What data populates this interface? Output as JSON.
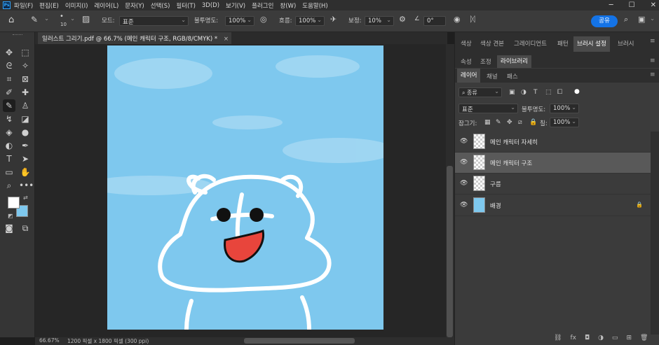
{
  "menubar": {
    "logo": "Ps",
    "items": [
      "파일(F)",
      "편집(E)",
      "이미지(I)",
      "레이어(L)",
      "문자(Y)",
      "선택(S)",
      "필터(T)",
      "3D(D)",
      "보기(V)",
      "플러그인",
      "창(W)",
      "도움말(H)"
    ]
  },
  "options": {
    "brush_size": "10",
    "mode_label": "모드:",
    "mode_value": "표준",
    "opacity_label": "불투명도:",
    "opacity_value": "100%",
    "flow_label": "흐름:",
    "flow_value": "100%",
    "smoothing_label": "보정:",
    "smoothing_value": "10%",
    "angle_value": "0°",
    "share_label": "공유"
  },
  "document": {
    "tab_title": "일러스트 그리기.pdf @ 66.7% (메인 캐릭터 구조, RGB/8/CMYK) *",
    "close": "×",
    "zoom": "66.67%",
    "info": "1200 픽셀 x 1800 픽셀 (300 ppi)"
  },
  "panels": {
    "top_tabs": [
      "색상",
      "색상 견본",
      "그레이디언트",
      "패턴",
      "브러시 설정",
      "브러시"
    ],
    "second_tabs": [
      "속성",
      "조정",
      "라이브러리"
    ],
    "layer_tabs": [
      "레이어",
      "채널",
      "패스"
    ],
    "filter_kind": "종류",
    "blend_mode": "표준",
    "opacity_label": "불투명도:",
    "opacity_value": "100%",
    "lock_label": "잠그기:",
    "fill_label": "칠:",
    "fill_value": "100%"
  },
  "layers": [
    {
      "name": "메인 캐릭터 자세히",
      "selected": false,
      "locked": false,
      "thumb": "transparent"
    },
    {
      "name": "메인 캐릭터 구조",
      "selected": true,
      "locked": false,
      "thumb": "transparent"
    },
    {
      "name": "구름",
      "selected": false,
      "locked": false,
      "thumb": "transparent"
    },
    {
      "name": "배경",
      "selected": false,
      "locked": true,
      "thumb": "blue"
    }
  ],
  "colors": {
    "canvas_sky": "#7ec8ee",
    "accent": "#1473e6",
    "mouth": "#e8453c",
    "background_thumb": "#7ec8ee"
  }
}
